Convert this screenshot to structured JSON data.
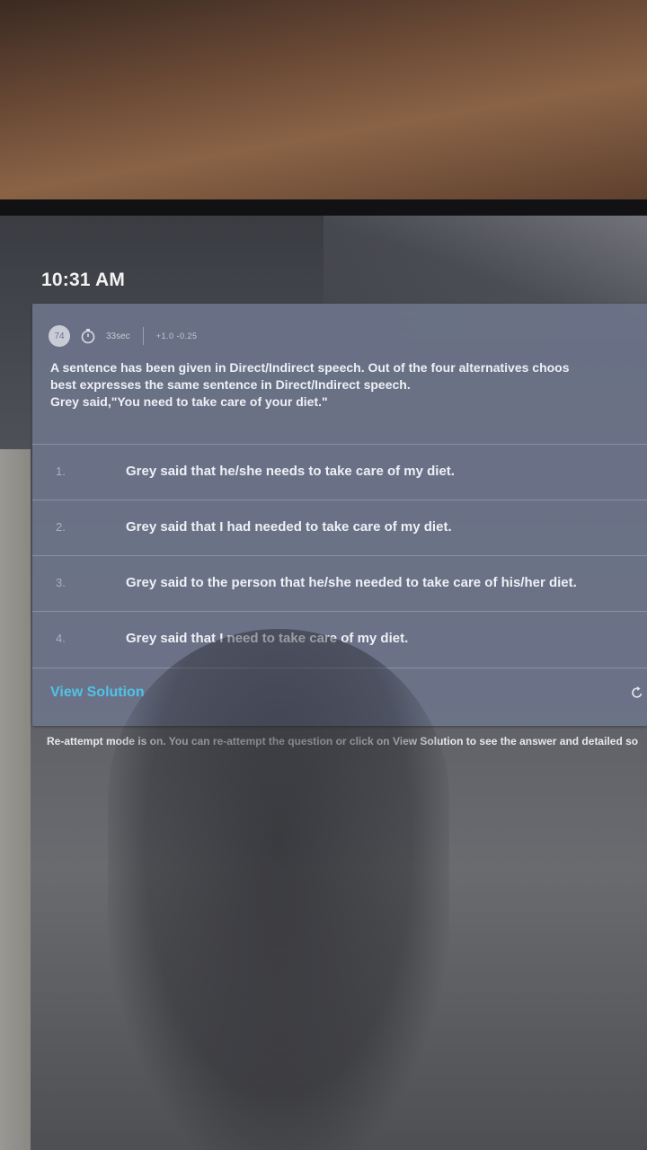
{
  "status_bar": {
    "time": "10:31 AM"
  },
  "question_card": {
    "question_number": "74",
    "timer_icon": "stopwatch-icon",
    "time_spent": "33sec",
    "marks": "+1.0  -0.25",
    "instruction": "A sentence has been given in Direct/Indirect speech. Out of the four alternatives choos",
    "instruction_line2": "best expresses the same sentence in Direct/Indirect speech.",
    "sentence": "Grey said,\"You need to take care of your diet.\"",
    "options": [
      {
        "number": "1.",
        "text": "Grey said that he/she needs to  take care of my diet."
      },
      {
        "number": "2.",
        "text": "Grey said that I had needed to  take care of my diet."
      },
      {
        "number": "3.",
        "text": "Grey said to the person that he/she needed to take care of his/her diet."
      },
      {
        "number": "4.",
        "text": "Grey said that I need to  take care of my diet."
      }
    ],
    "view_solution_label": "View Solution",
    "reattempt_icon": "refresh-icon"
  },
  "footer_note": "Re-attempt mode is on. You can re-attempt the question or click on View Solution to see the answer and detailed so",
  "colors": {
    "card_background": "#6c748a",
    "link": "#4fc3e6",
    "text": "#eef0f6"
  }
}
